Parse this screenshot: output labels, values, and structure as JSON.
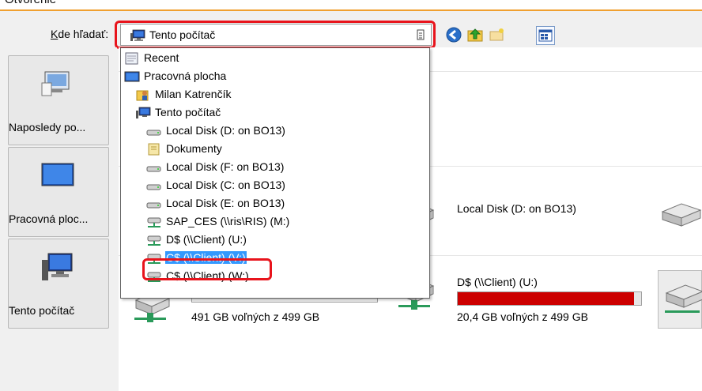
{
  "window": {
    "title": "Otvorenie"
  },
  "lookin": {
    "label_prefix": "K",
    "label_rest": "de hľadať:",
    "value": "Tento počítač"
  },
  "toolbar": {
    "icons": [
      "back-icon",
      "up-folder-icon",
      "new-folder-icon",
      "view-menu-icon"
    ]
  },
  "places": [
    {
      "label": "Naposledy po...",
      "icon": "recent-places-icon"
    },
    {
      "label": "Pracovná ploc...",
      "icon": "desktop-icon"
    },
    {
      "label": "Tento počítač",
      "icon": "computer-icon"
    }
  ],
  "dropdown": {
    "items": [
      {
        "label": "Recent",
        "icon": "recent-icon",
        "indent": 0
      },
      {
        "label": "Pracovná plocha",
        "icon": "desktop-icon",
        "indent": 0
      },
      {
        "label": "Milan Katrenčík",
        "icon": "user-folder-icon",
        "indent": 1
      },
      {
        "label": "Tento počítač",
        "icon": "computer-icon",
        "indent": 1
      },
      {
        "label": "Local Disk (D: on BO13)",
        "icon": "drive-icon",
        "indent": 2
      },
      {
        "label": "Dokumenty",
        "icon": "documents-icon",
        "indent": 2
      },
      {
        "label": "Local Disk (F: on BO13)",
        "icon": "drive-icon",
        "indent": 2
      },
      {
        "label": "Local Disk (C: on BO13)",
        "icon": "drive-icon",
        "indent": 2
      },
      {
        "label": "Local Disk (E: on BO13)",
        "icon": "drive-icon",
        "indent": 2
      },
      {
        "label": "SAP_CES (\\\\ris\\RIS) (M:)",
        "icon": "network-drive-icon",
        "indent": 2
      },
      {
        "label": "D$ (\\\\Client) (U:)",
        "icon": "network-drive-icon",
        "indent": 2
      },
      {
        "label": "C$ (\\\\Client) (V:)",
        "icon": "network-drive-icon",
        "indent": 2,
        "selected": true
      },
      {
        "label": "C$ (\\\\Client) (W:)",
        "icon": "network-drive-icon",
        "indent": 2
      }
    ]
  },
  "content": {
    "drives": [
      {
        "name": "Local Disk (D: on BO13)",
        "icon": "hard-disk-icon"
      },
      {
        "name": "D$ (\\\\Client) (U:)",
        "free": "20,4 GB voľných z 499 GB",
        "used_fraction": 0.96,
        "bar_color": "#cc0000",
        "icon": "network-drive-icon"
      },
      {
        "free": "491 GB voľných z 499 GB",
        "icon": "network-drive-icon"
      }
    ]
  },
  "colors": {
    "highlight_border": "#e8141c",
    "selection": "#3399ff",
    "title_accent": "#f0a030"
  }
}
